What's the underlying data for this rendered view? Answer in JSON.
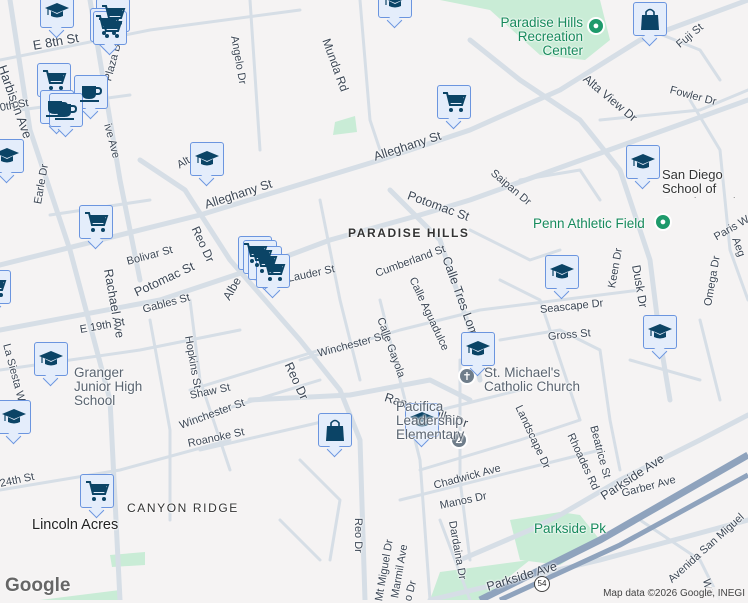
{
  "map": {
    "neighborhoods": [
      "PARADISE HILLS",
      "CANYON RIDGE"
    ],
    "city": "Lincoln Acres",
    "pois": {
      "rec_center": "Paradise Hills Recreation Center",
      "penn_field": "Penn Athletic Field",
      "school_creative": "San Diego School of Creative and",
      "granger": "Granger Junior High School",
      "st_michaels": "St. Michael's Catholic Church",
      "pacifica": "Pacifica Leadership Elementary",
      "parkside_pk": "Parkside Pk"
    },
    "streets": {
      "e8th": "E 8th St",
      "harbison": "Harbison Ave",
      "plaza": "Plaza Blvd",
      "e10th": "0th St",
      "olive": "ive Ave",
      "earle": "Earle Dr",
      "angelo": "Angelo Dr",
      "munda": "Munda Rd",
      "alleghany1": "Alleghany St",
      "alleghany2": "Alleghany St",
      "reo1": "Reo Dr",
      "bolivar": "Bolivar St",
      "potomac1": "Potomac St",
      "rachael": "Rachael Ave",
      "albert": "Albe",
      "lauder": "Lauder St",
      "potomac2": "Potomac St",
      "saipan": "Saipan Dr",
      "altaview": "Alta View Dr",
      "fowler": "Fowler Dr",
      "fuji": "Fuji St",
      "paris": "Paris W",
      "aeg": "Aeg",
      "cumberland": "Cumberland St",
      "aguadulce": "Calle Aguadulce",
      "treslomas": "Calle Tres Lomas",
      "keen": "Keen Dr",
      "dusk": "Dusk Dr",
      "omega": "Omega Dr",
      "seascape": "Seascape Dr",
      "gross": "Gross St",
      "gables": "Gables St",
      "e19th": "E 19th St",
      "hopkins": "Hopkins St",
      "winchester1": "Winchester St",
      "gayola": "Calle Gayola",
      "lasiesta": "La Siesta Wa",
      "shaw": "Shaw St",
      "winchester2": "Winchester St",
      "roanoke": "Roanoke St",
      "reo2": "Reo Dr",
      "rancho": "Rancho Hills Dr",
      "landscape": "Landscape Dr",
      "rhoades": "Rhoades Rd",
      "beatrice": "Beatrice St",
      "chadwick": "Chadwick Ave",
      "manos": "Manos Dr",
      "parkside1": "Parkside Ave",
      "garber": "Garber Ave",
      "e24th": "24th St",
      "reo3": "Reo Dr",
      "dardaina": "Dardaina Dr",
      "mtmiguel": "Mt Miguel Dr",
      "marmil": "Marmil Ave",
      "reo4": "o Dr",
      "parkside2": "Parkside Ave",
      "sanmiguel": "Avenida San Miguel",
      "will": "Will",
      "alt": "Alt"
    },
    "highway_shield": "54",
    "logo": "Google",
    "attribution": "Map data ©2026 Google, INEGI"
  },
  "colors": {
    "marker_fill": "#e4edfb",
    "marker_border": "#6b95df",
    "icon": "#0b4466",
    "park": "#c9ecd6",
    "highway": "#8fa3bd",
    "road": "#d6dee6"
  }
}
